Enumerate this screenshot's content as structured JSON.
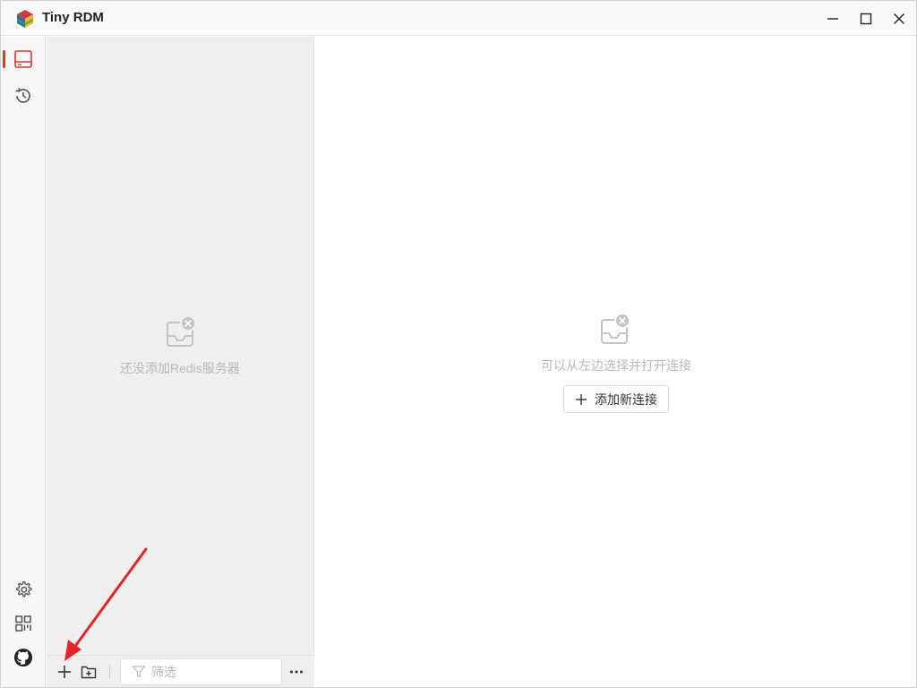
{
  "window": {
    "title": "Tiny RDM",
    "icons": {
      "minimize": "minimize-icon",
      "maximize": "maximize-icon",
      "close": "close-icon"
    }
  },
  "ribbon": {
    "top_items": [
      {
        "name": "server-icon",
        "active": true
      },
      {
        "name": "history-icon",
        "active": false
      }
    ],
    "bottom_items": [
      {
        "name": "gear-icon"
      },
      {
        "name": "apps-icon"
      },
      {
        "name": "github-icon"
      }
    ],
    "accent_color": "#d33a31"
  },
  "sidebar": {
    "empty_message": "还没添加Redis服务器",
    "filter_placeholder": "筛选",
    "footer_icons": [
      "plus-icon",
      "folder-add-icon",
      "filter-icon",
      "more-icon"
    ]
  },
  "main": {
    "empty_message": "可以从左边选择并打开连接",
    "add_connection_label": "添加新连接"
  }
}
